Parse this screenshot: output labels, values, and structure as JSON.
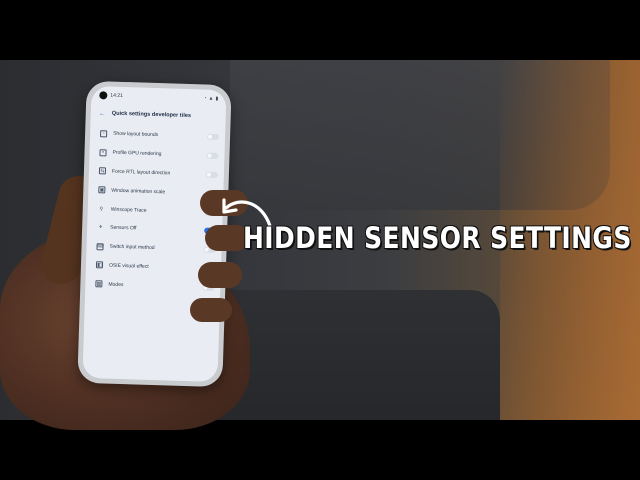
{
  "phone": {
    "status_bar": {
      "time": "14:21",
      "icons": [
        "wifi-icon",
        "signal-icon",
        "battery-icon"
      ]
    },
    "app_bar": {
      "title": "Quick settings developer tiles"
    },
    "tiles": [
      {
        "label": "Show layout bounds",
        "icon": "layout-bounds-icon",
        "enabled": false
      },
      {
        "label": "Profile GPU rendering",
        "icon": "gpu-icon",
        "enabled": false
      },
      {
        "label": "Force RTL layout direction",
        "icon": "rtl-icon",
        "enabled": false
      },
      {
        "label": "Window animation scale",
        "icon": "animation-icon",
        "enabled": false
      },
      {
        "label": "Winscope Trace",
        "icon": "winscope-icon",
        "enabled": false
      },
      {
        "label": "Sensors Off",
        "icon": "sensors-off-icon",
        "enabled": true
      },
      {
        "label": "Switch input method",
        "icon": "keyboard-icon",
        "enabled": false
      },
      {
        "label": "OSIE visual effect",
        "icon": "visual-effect-icon",
        "enabled": false
      },
      {
        "label": "Modes",
        "icon": "modes-icon",
        "enabled": false
      }
    ],
    "accent_color": "#2f6fe6"
  },
  "overlay": {
    "caption": "HIDDEN SENSOR SETTINGS",
    "caption_color": "#ffffff",
    "arrow_icon": "curved-arrow-icon"
  }
}
